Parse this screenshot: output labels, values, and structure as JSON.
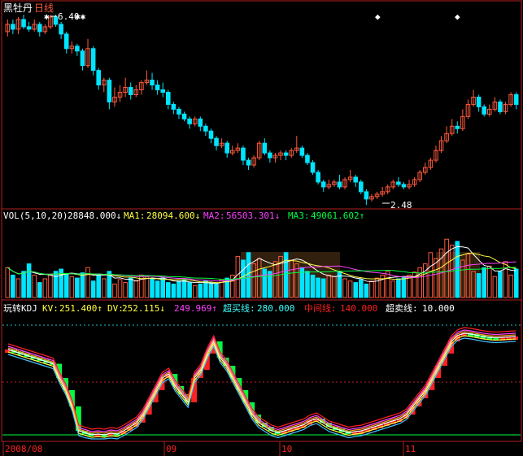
{
  "colors": {
    "background": "#000000",
    "frame": "#b02020",
    "up": "#ff5a3c",
    "down": "#00e5ff",
    "white": "#ffffff",
    "yellow": "#ffff40",
    "magenta": "#ff40ff",
    "green": "#00ff40",
    "red": "#ff2020",
    "cyan_line": "#40c0ff",
    "orange": "#ff9a20",
    "dotted_cyan": "#20c0c0",
    "dotted_red": "#c02020",
    "box_fill": "#5a3a1a"
  },
  "header": {
    "stock_name": "黑牡丹",
    "period": "日线"
  },
  "price_panel": {
    "high_label": "6.40",
    "low_label": "2.48"
  },
  "vol_panel": {
    "name": "VOL(5,10,20)",
    "vol_value": "28848.000↓",
    "ma1_label": "MA1:",
    "ma1_value": "28094.600↓",
    "ma2_label": "MA2:",
    "ma2_value": "56503.301↓",
    "ma3_label": "MA3:",
    "ma3_value": "49061.602↑"
  },
  "kdj_panel": {
    "name": "玩转KDJ",
    "kv_label": "KV:",
    "kv_value": "251.400↑",
    "dv_label": "DV:",
    "dv_value": "252.115↓",
    "j_value": "249.969↑",
    "overbought_label": "超买线:",
    "overbought_value": "280.000",
    "middle_label": "中间线:",
    "middle_value": "140.000",
    "oversold_label": "超卖线:",
    "oversold_value": "10.000"
  },
  "x_axis": {
    "labels": [
      "2008/08",
      "09",
      "10",
      "11"
    ]
  },
  "chart_data": {
    "type": "candlestick",
    "price": {
      "high": 6.4,
      "low": 2.48,
      "candles": [
        [
          6.05,
          6.2,
          6.3,
          5.95
        ],
        [
          6.2,
          6.1,
          6.3,
          6.0
        ],
        [
          6.1,
          6.3,
          6.35,
          6.0
        ],
        [
          6.3,
          6.15,
          6.4,
          6.1
        ],
        [
          6.15,
          6.1,
          6.25,
          6.05
        ],
        [
          6.1,
          6.2,
          6.3,
          6.05
        ],
        [
          6.2,
          6.05,
          6.25,
          5.95
        ],
        [
          6.05,
          6.15,
          6.2,
          6.0
        ],
        [
          6.15,
          6.35,
          6.4,
          6.1
        ],
        [
          6.35,
          6.2,
          6.4,
          6.15
        ],
        [
          6.2,
          6.0,
          6.25,
          5.9
        ],
        [
          6.0,
          5.7,
          6.05,
          5.6
        ],
        [
          5.7,
          5.75,
          5.85,
          5.6
        ],
        [
          5.75,
          5.65,
          5.8,
          5.55
        ],
        [
          5.65,
          5.35,
          5.7,
          5.25
        ],
        [
          5.35,
          5.7,
          5.9,
          5.3
        ],
        [
          5.7,
          5.25,
          5.75,
          5.15
        ],
        [
          5.25,
          4.95,
          5.3,
          4.85
        ],
        [
          4.95,
          5.05,
          5.1,
          4.8
        ],
        [
          5.05,
          4.6,
          5.1,
          4.45
        ],
        [
          4.6,
          4.7,
          4.9,
          4.5
        ],
        [
          4.7,
          4.8,
          4.95,
          4.6
        ],
        [
          4.8,
          4.9,
          5.1,
          4.7
        ],
        [
          4.9,
          4.75,
          5.0,
          4.65
        ],
        [
          4.75,
          4.85,
          4.95,
          4.7
        ],
        [
          4.85,
          5.0,
          5.05,
          4.75
        ],
        [
          5.0,
          5.05,
          5.25,
          4.95
        ],
        [
          5.05,
          4.95,
          5.2,
          4.85
        ],
        [
          4.95,
          4.85,
          5.05,
          4.75
        ],
        [
          4.85,
          4.8,
          5.0,
          4.7
        ],
        [
          4.8,
          4.55,
          4.85,
          4.45
        ],
        [
          4.55,
          4.45,
          4.6,
          4.35
        ],
        [
          4.45,
          4.35,
          4.5,
          4.25
        ],
        [
          4.35,
          4.25,
          4.4,
          4.2
        ],
        [
          4.25,
          4.15,
          4.3,
          4.05
        ],
        [
          4.15,
          4.25,
          4.3,
          4.1
        ],
        [
          4.25,
          4.1,
          4.3,
          4.0
        ],
        [
          4.1,
          4.0,
          4.15,
          3.9
        ],
        [
          4.0,
          3.85,
          4.05,
          3.75
        ],
        [
          3.85,
          3.7,
          3.9,
          3.6
        ],
        [
          3.7,
          3.75,
          3.85,
          3.65
        ],
        [
          3.75,
          3.55,
          3.8,
          3.45
        ],
        [
          3.55,
          3.6,
          3.7,
          3.5
        ],
        [
          3.6,
          3.65,
          3.75,
          3.55
        ],
        [
          3.65,
          3.4,
          3.7,
          3.3
        ],
        [
          3.4,
          3.3,
          3.45,
          3.2
        ],
        [
          3.3,
          3.45,
          3.5,
          3.25
        ],
        [
          3.45,
          3.75,
          3.8,
          3.4
        ],
        [
          3.75,
          3.55,
          3.85,
          3.5
        ],
        [
          3.55,
          3.45,
          3.6,
          3.35
        ],
        [
          3.45,
          3.5,
          3.55,
          3.35
        ],
        [
          3.5,
          3.55,
          3.6,
          3.4
        ],
        [
          3.55,
          3.5,
          3.6,
          3.4
        ],
        [
          3.5,
          3.6,
          3.65,
          3.45
        ],
        [
          3.6,
          3.65,
          3.9,
          3.55
        ],
        [
          3.65,
          3.5,
          3.7,
          3.45
        ],
        [
          3.5,
          3.35,
          3.55,
          3.3
        ],
        [
          3.35,
          3.15,
          3.4,
          3.1
        ],
        [
          3.15,
          2.95,
          3.2,
          2.9
        ],
        [
          2.95,
          2.85,
          3.0,
          2.75
        ],
        [
          2.85,
          2.9,
          3.0,
          2.8
        ],
        [
          2.9,
          2.95,
          3.0,
          2.85
        ],
        [
          2.95,
          2.85,
          3.1,
          2.8
        ],
        [
          2.85,
          3.0,
          3.05,
          2.8
        ],
        [
          3.0,
          3.05,
          3.2,
          2.95
        ],
        [
          3.05,
          2.95,
          3.1,
          2.85
        ],
        [
          2.95,
          2.75,
          3.0,
          2.7
        ],
        [
          2.75,
          2.6,
          2.8,
          2.48
        ],
        [
          2.6,
          2.65,
          2.7,
          2.55
        ],
        [
          2.65,
          2.7,
          2.75,
          2.6
        ],
        [
          2.7,
          2.75,
          2.85,
          2.65
        ],
        [
          2.75,
          2.85,
          2.9,
          2.7
        ],
        [
          2.85,
          2.95,
          3.0,
          2.8
        ],
        [
          2.95,
          2.9,
          3.05,
          2.85
        ],
        [
          2.9,
          2.85,
          2.95,
          2.8
        ],
        [
          2.85,
          2.9,
          3.0,
          2.8
        ],
        [
          2.9,
          3.0,
          3.05,
          2.85
        ],
        [
          3.0,
          3.15,
          3.2,
          2.95
        ],
        [
          3.15,
          3.25,
          3.35,
          3.1
        ],
        [
          3.25,
          3.4,
          3.45,
          3.2
        ],
        [
          3.4,
          3.6,
          3.7,
          3.35
        ],
        [
          3.6,
          3.8,
          3.9,
          3.55
        ],
        [
          3.8,
          3.95,
          4.1,
          3.75
        ],
        [
          3.95,
          4.1,
          4.25,
          3.9
        ],
        [
          4.1,
          4.05,
          4.2,
          3.95
        ],
        [
          4.05,
          4.3,
          4.45,
          4.0
        ],
        [
          4.3,
          4.55,
          4.65,
          4.25
        ],
        [
          4.55,
          4.7,
          4.85,
          4.5
        ],
        [
          4.7,
          4.5,
          4.75,
          4.4
        ],
        [
          4.5,
          4.35,
          4.55,
          4.3
        ],
        [
          4.35,
          4.45,
          4.55,
          4.3
        ],
        [
          4.45,
          4.6,
          4.7,
          4.4
        ],
        [
          4.6,
          4.4,
          4.65,
          4.35
        ],
        [
          4.4,
          4.55,
          4.6,
          4.35
        ],
        [
          4.55,
          4.75,
          4.8,
          4.5
        ],
        [
          4.75,
          4.55,
          4.8,
          4.45
        ]
      ]
    },
    "volume": {
      "max": 100,
      "values": [
        40,
        30,
        25,
        35,
        45,
        30,
        20,
        25,
        30,
        35,
        38,
        32,
        28,
        26,
        33,
        40,
        22,
        30,
        25,
        35,
        18,
        24,
        20,
        26,
        22,
        30,
        28,
        25,
        22,
        26,
        20,
        18,
        22,
        24,
        20,
        16,
        18,
        22,
        20,
        18,
        24,
        26,
        30,
        55,
        50,
        60,
        45,
        52,
        38,
        35,
        48,
        55,
        60,
        50,
        45,
        40,
        35,
        30,
        26,
        25,
        30,
        28,
        35,
        25,
        22,
        20,
        24,
        18,
        22,
        26,
        30,
        35,
        22,
        25,
        28,
        30,
        34,
        40,
        45,
        60,
        52,
        65,
        78,
        70,
        75,
        50,
        58,
        35,
        32,
        40,
        42,
        28,
        35,
        48,
        30,
        38
      ],
      "ma_values": {
        "ma1": 28094.6,
        "ma2": 56503.301,
        "ma3": 49061.602
      }
    },
    "kdj": {
      "k": 251.4,
      "d": 252.115,
      "j": 249.969,
      "overbought": 280,
      "middle": 140,
      "oversold": 10,
      "histogram": [
        220,
        215,
        210,
        205,
        200,
        195,
        190,
        185,
        150,
        120,
        80,
        20,
        15,
        10,
        12,
        10,
        14,
        12,
        20,
        30,
        40,
        60,
        90,
        120,
        150,
        160,
        130,
        110,
        90,
        150,
        170,
        210,
        240,
        200,
        180,
        150,
        120,
        90,
        60,
        40,
        30,
        20,
        15,
        20,
        25,
        30,
        35,
        45,
        50,
        40,
        30,
        25,
        20,
        15,
        18,
        20,
        25,
        30,
        35,
        40,
        45,
        50,
        60,
        80,
        100,
        120,
        150,
        180,
        210,
        240,
        255,
        260,
        258,
        255,
        252,
        250,
        249,
        250,
        251,
        252
      ]
    }
  }
}
